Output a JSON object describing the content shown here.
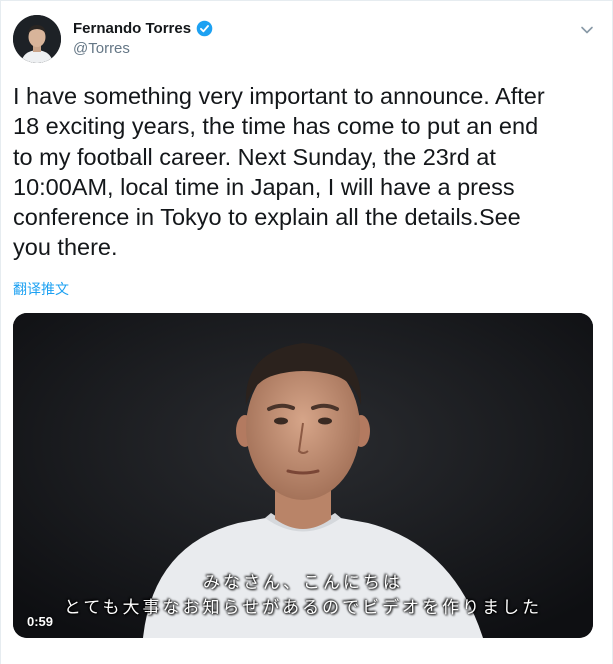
{
  "tweet": {
    "display_name": "Fernando Torres",
    "handle": "@Torres",
    "verified": true,
    "text": "I have something very important to announce. After\n18 exciting years, the time has come to put an end\nto my football career. Next Sunday, the 23rd at\n10:00AM, local time in Japan, I will have a press\nconference in Tokyo to explain all the details.See\nyou there.",
    "translate_label": "翻译推文"
  },
  "media": {
    "type": "video",
    "subtitle_line1": "みなさん、こんにちは",
    "subtitle_line2": "とても大事なお知らせがあるのでビデオを作りました",
    "duration": "0:59"
  },
  "icons": {
    "verified": "verified-badge-icon",
    "caret": "chevron-down-icon"
  },
  "colors": {
    "link": "#1da1f2",
    "secondary_text": "#657786",
    "primary_text": "#14171a"
  }
}
